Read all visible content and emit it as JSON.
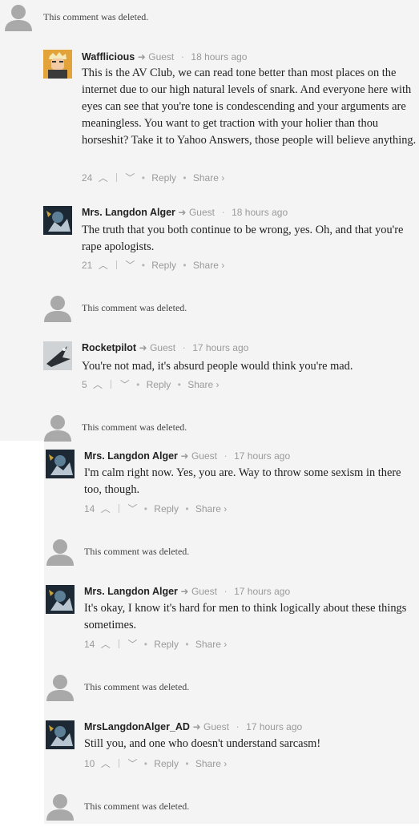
{
  "deleted_text": "This comment was deleted.",
  "guest_label": "Guest",
  "reply_label": "Reply",
  "share_label": "Share ›",
  "comments": [
    {
      "author": "Wafflicious",
      "time": "18 hours ago",
      "text": "This is the AV Club, we can read tone better than most places on the internet due to our high natural levels of snark. And everyone here with eyes can see that you're tone is condescending and your arguments are meaningless. You want to get traction with your holier than thou horseshit? Take it to Yahoo Answers, those people will believe anything.",
      "votes": "24"
    },
    {
      "author": "Mrs. Langdon Alger",
      "time": "18 hours ago",
      "text": "The truth that you both continue to be wrong, yes. Oh, and that you're rape apologists.",
      "votes": "21"
    },
    {
      "author": "Rocketpilot",
      "time": "17 hours ago",
      "text": "You're not mad, it's absurd people would think you're mad.",
      "votes": "5"
    },
    {
      "author": "Mrs. Langdon Alger",
      "time": "17 hours ago",
      "text": "I'm calm right now. Yes, you are. Way to throw some sexism in there too, though.",
      "votes": "14"
    },
    {
      "author": "Mrs. Langdon Alger",
      "time": "17 hours ago",
      "text": "It's okay, I know it's hard for men to think logically about these things sometimes.",
      "votes": "14"
    },
    {
      "author": "MrsLangdonAlger_AD",
      "time": "17 hours ago",
      "text": "Still you, and one who doesn't understand sarcasm!",
      "votes": "10"
    }
  ]
}
